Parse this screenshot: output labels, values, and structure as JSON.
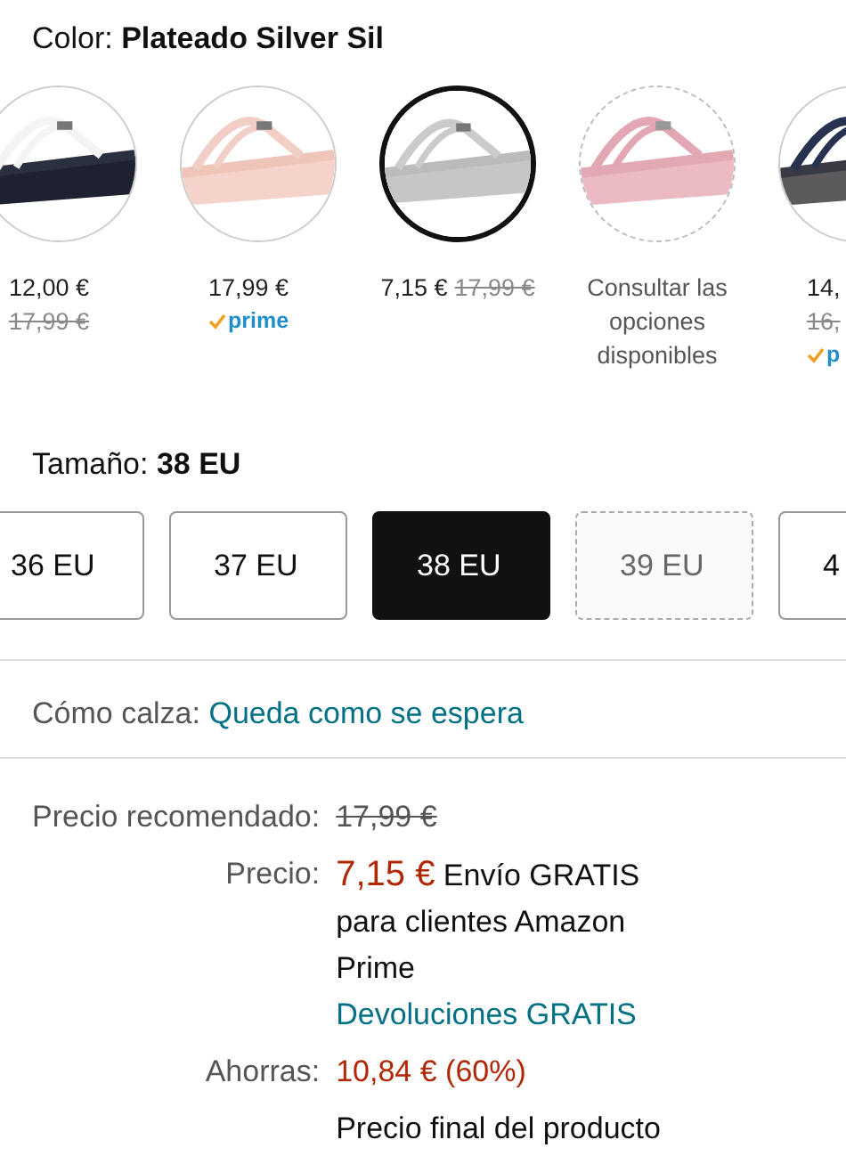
{
  "color_label": "Color:",
  "color_value": "Plateado Silver Sil",
  "swatches": [
    {
      "kind": "stacked",
      "price": "12,00 €",
      "old_price": "17,99 €",
      "selected": false,
      "available": true
    },
    {
      "kind": "stacked",
      "price": "17,99 €",
      "badge": "prime",
      "selected": false,
      "available": true
    },
    {
      "kind": "inline",
      "price": "7,15 €",
      "old_price": "17,99 €",
      "selected": true,
      "available": true
    },
    {
      "kind": "options",
      "text": "Consultar las opciones disponibles",
      "selected": false,
      "available": false
    },
    {
      "kind": "stacked",
      "price": "14,",
      "old_price": "16,",
      "badge": "p",
      "selected": false,
      "available": true
    }
  ],
  "size_label": "Tamaño:",
  "size_value": "38 EU",
  "sizes": [
    {
      "label": "36 EU",
      "selected": false,
      "available": true
    },
    {
      "label": "37 EU",
      "selected": false,
      "available": true
    },
    {
      "label": "38 EU",
      "selected": true,
      "available": true
    },
    {
      "label": "39 EU",
      "selected": false,
      "available": false
    },
    {
      "label": "4",
      "selected": false,
      "available": true
    }
  ],
  "fit": {
    "label": "Cómo calza:",
    "value": "Queda como se espera"
  },
  "pricing": {
    "list_price_label": "Precio recomendado:",
    "list_price": "17,99 €",
    "price_label": "Precio:",
    "price": "7,15 €",
    "shipping_note": "Envío GRATIS para clientes Amazon Prime",
    "returns": "Devoluciones GRATIS",
    "savings_label": "Ahorras:",
    "savings": "10,84 € (60%)",
    "final_note": "Precio final del producto"
  }
}
